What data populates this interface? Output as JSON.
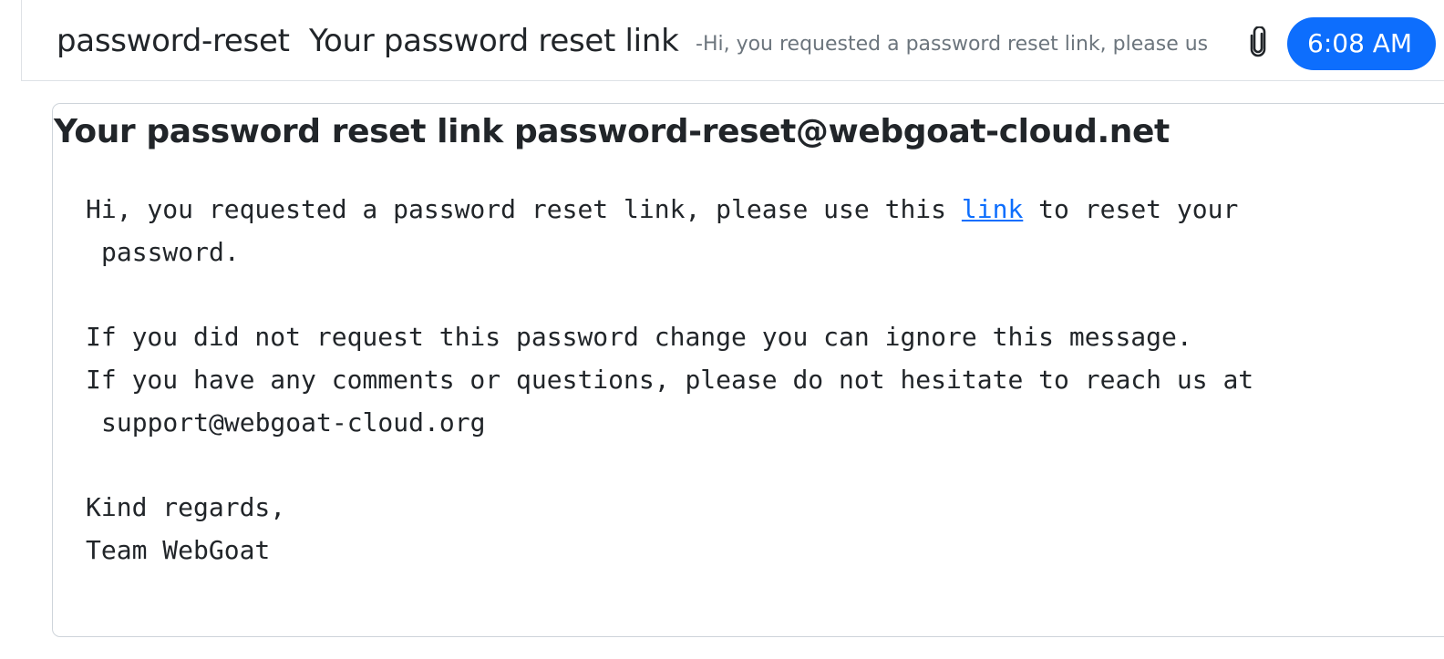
{
  "inbox_row": {
    "sender": "password-reset",
    "subject": "Your password reset link",
    "preview": "-Hi, you requested a password reset link, please us",
    "time": "6:08 AM"
  },
  "message": {
    "subject": "Your password reset link",
    "from": "password-reset@webgoat-cloud.net",
    "body": {
      "line1_before": "Hi, you requested a password reset link, please use this ",
      "link_text": "link",
      "line1_after": " to reset your",
      "line1_cont": "password.",
      "line2": "If you did not request this password change you can ignore this message.",
      "line3": "If you have any comments or questions, please do not hesitate to reach us at",
      "line3_cont": "support@webgoat-cloud.org",
      "closing": "Kind regards,",
      "signature": "Team WebGoat"
    }
  },
  "colors": {
    "badge": "#0d6efd",
    "link": "#0d6efd",
    "muted": "#6c757d",
    "text": "#212529"
  },
  "icons": {
    "attachment": "paperclip-icon"
  }
}
